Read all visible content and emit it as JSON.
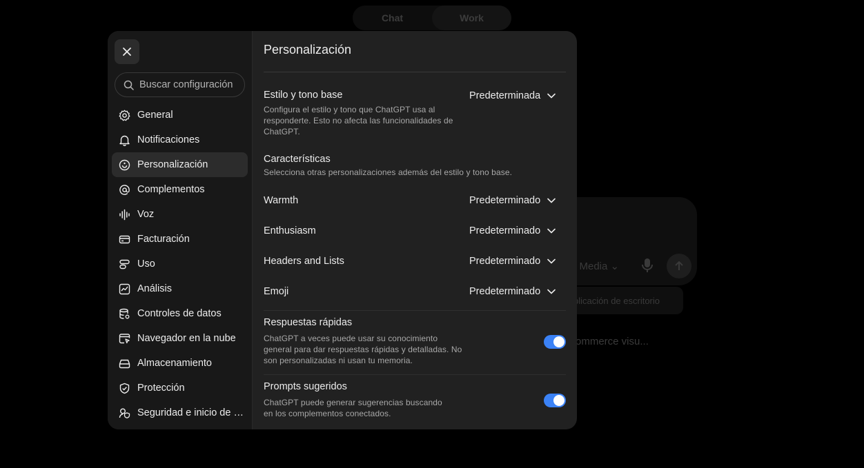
{
  "background": {
    "mode_toggle": [
      "Chat",
      "Work"
    ],
    "composer_model": "l Media",
    "desktop_chip": "plicación de escritorio",
    "suggestion": "ommerce visu..."
  },
  "sidebar": {
    "search_placeholder": "Buscar configuración",
    "items": [
      {
        "label": "General",
        "icon": "gear-icon"
      },
      {
        "label": "Notificaciones",
        "icon": "bell-icon"
      },
      {
        "label": "Personalización",
        "icon": "personalization-icon",
        "active": true
      },
      {
        "label": "Complementos",
        "icon": "at-icon"
      },
      {
        "label": "Voz",
        "icon": "waveform-icon"
      },
      {
        "label": "Facturación",
        "icon": "credit-card-icon"
      },
      {
        "label": "Uso",
        "icon": "usage-icon"
      },
      {
        "label": "Análisis",
        "icon": "chart-icon"
      },
      {
        "label": "Controles de datos",
        "icon": "database-icon"
      },
      {
        "label": "Navegador en la nube",
        "icon": "cloud-browser-icon"
      },
      {
        "label": "Almacenamiento",
        "icon": "storage-icon"
      },
      {
        "label": "Protección",
        "icon": "shield-icon"
      },
      {
        "label": "Seguridad e inicio de sesión",
        "icon": "security-icon"
      }
    ]
  },
  "content": {
    "title": "Personalización",
    "base_style": {
      "title": "Estilo y tono base",
      "desc": "Configura el estilo y tono que ChatGPT usa al responderte. Esto no afecta las funcionalidades de ChatGPT.",
      "value": "Predeterminada"
    },
    "characteristics": {
      "title": "Características",
      "desc": "Selecciona otras personalizaciones además del estilo y tono base."
    },
    "traits": [
      {
        "label": "Warmth",
        "value": "Predeterminado"
      },
      {
        "label": "Enthusiasm",
        "value": "Predeterminado"
      },
      {
        "label": "Headers and Lists",
        "value": "Predeterminado"
      },
      {
        "label": "Emoji",
        "value": "Predeterminado"
      }
    ],
    "quick_answers": {
      "title": "Respuestas rápidas",
      "desc": "ChatGPT a veces puede usar su conocimiento general para dar respuestas rápidas y detalladas. No son personalizadas ni usan tu memoria.",
      "enabled": true
    },
    "suggested_prompts": {
      "title": "Prompts sugeridos",
      "desc": "ChatGPT puede generar sugerencias buscando en los complementos conectados.",
      "enabled": true
    }
  },
  "colors": {
    "toggle_on": "#3b82f6",
    "modal_bg": "#212121",
    "sidebar_bg": "#181818"
  }
}
